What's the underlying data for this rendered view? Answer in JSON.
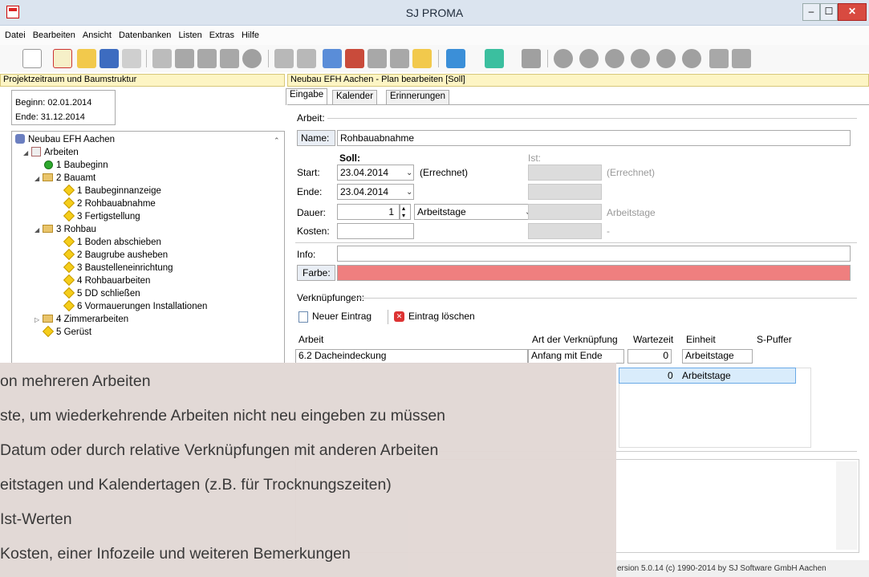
{
  "window": {
    "title": "SJ PROMA",
    "close": "✕",
    "max": "☐",
    "min": "–"
  },
  "menu": [
    "Datei",
    "Bearbeiten",
    "Ansicht",
    "Datenbanken",
    "Listen",
    "Extras",
    "Hilfe"
  ],
  "left": {
    "header": "Projektzeitraum und Baumstruktur",
    "begin": "Beginn: 02.01.2014",
    "end": "Ende:   31.12.2014",
    "tree": [
      {
        "text": "Neubau EFH Aachen",
        "kind": "root",
        "level": 0
      },
      {
        "text": "Arbeiten",
        "kind": "folder",
        "level": 1
      },
      {
        "text": "1 Baubeginn",
        "kind": "green",
        "level": 2
      },
      {
        "text": "2 Bauamt",
        "kind": "folder",
        "level": 2
      },
      {
        "text": "1 Baubeginnanzeige",
        "kind": "dia",
        "level": 3
      },
      {
        "text": "2 Rohbauabnahme",
        "kind": "dia",
        "level": 3
      },
      {
        "text": "3 Fertigstellung",
        "kind": "dia",
        "level": 3
      },
      {
        "text": "3 Rohbau",
        "kind": "folder",
        "level": 2
      },
      {
        "text": "1 Boden abschieben",
        "kind": "dia",
        "level": 3
      },
      {
        "text": "2 Baugrube ausheben",
        "kind": "dia",
        "level": 3
      },
      {
        "text": "3 Baustelleneinrichtung",
        "kind": "dia",
        "level": 3
      },
      {
        "text": "4 Rohbauarbeiten",
        "kind": "dia",
        "level": 3
      },
      {
        "text": "5 DD schließen",
        "kind": "dia",
        "level": 3
      },
      {
        "text": "6 Vormauerungen Installationen",
        "kind": "dia",
        "level": 3
      },
      {
        "text": "4 Zimmerarbeiten",
        "kind": "folder",
        "level": 2
      },
      {
        "text": "5 Gerüst",
        "kind": "dia",
        "level": 2
      }
    ]
  },
  "right": {
    "header": "Neubau EFH Aachen - Plan bearbeiten [Soll]",
    "tabs": [
      "Eingabe",
      "Kalender",
      "Erinnerungen"
    ],
    "arbeit_label": "Arbeit:",
    "name_label": "Name:",
    "name_value": "Rohbauabnahme",
    "soll": "Soll:",
    "ist": "Ist:",
    "start_label": "Start:",
    "start_value": "23.04.2014",
    "errechnet": "(Errechnet)",
    "errechnet_ist": "(Errechnet)",
    "ende_label": "Ende:",
    "ende_value": "23.04.2014",
    "dauer_label": "Dauer:",
    "dauer_value": "1",
    "unit": "Arbeitstage",
    "unit_ist": "Arbeitstage",
    "kosten_label": "Kosten:",
    "kosten_ist": "-",
    "info_label": "Info:",
    "farbe_label": "Farbe:",
    "farbe_color": "#ef7f7f",
    "verk_label": "Verknüpfungen:",
    "neu": "Neuer Eintrag",
    "loeschen": "Eintrag löschen",
    "cols": [
      "Arbeit",
      "Art der Verknüpfung",
      "Wartezeit",
      "Einheit",
      "S-Puffer"
    ],
    "row_arbeit": "6.2 Dacheindeckung",
    "row_art": "Anfang mit Ende",
    "row_wait": "0",
    "row_unit": "Arbeitstage",
    "grid_wait": "0",
    "grid_unit": "Arbeitstage"
  },
  "overlay": [
    "on mehreren Arbeiten",
    "ste, um wiederkehrende Arbeiten nicht neu eingeben zu müssen",
    " Datum oder durch relative Verknüpfungen mit anderen Arbeiten",
    "eitstagen und Kalendertagen (z.B. für Trocknungszeiten)",
    "Ist-Werten",
    "Kosten, einer Infozeile und weiteren Bemerkungen"
  ],
  "status": "ersion 5.0.14 (c) 1990-2014 by SJ Software GmbH Aachen"
}
